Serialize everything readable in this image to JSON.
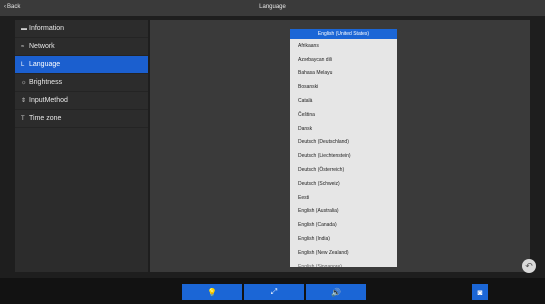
{
  "topbar": {
    "back_label": "Back",
    "title": "Language"
  },
  "sidebar": {
    "items": [
      {
        "label": "Information",
        "icon": "info-icon"
      },
      {
        "label": "Network",
        "icon": "wifi-icon"
      },
      {
        "label": "Language",
        "icon": "language-icon",
        "active": true
      },
      {
        "label": "Brightness",
        "icon": "brightness-icon"
      },
      {
        "label": "InputMethod",
        "icon": "input-method-icon"
      },
      {
        "label": "Time zone",
        "icon": "clock-icon"
      }
    ]
  },
  "language_list": {
    "selected": "English (United States)",
    "items": [
      "Afrikaans",
      "Azərbaycan dili",
      "Bahasa Melayu",
      "Bosanski",
      "Català",
      "Čeština",
      "Dansk",
      "Deutsch (Deutschland)",
      "Deutsch (Liechtenstein)",
      "Deutsch (Österreich)",
      "Deutsch (Schweiz)",
      "Eesti",
      "English (Australia)",
      "English (Canada)",
      "English (India)",
      "English (New Zealand)",
      "English (Singapore)"
    ]
  },
  "bottombar": {
    "buttons": [
      "lightbulb-icon",
      "cursor-icon",
      "volume-icon",
      "camera-icon"
    ]
  },
  "colors": {
    "accent": "#1b66d6",
    "background": "#1e1e1e",
    "panel": "#3a3a3a"
  }
}
